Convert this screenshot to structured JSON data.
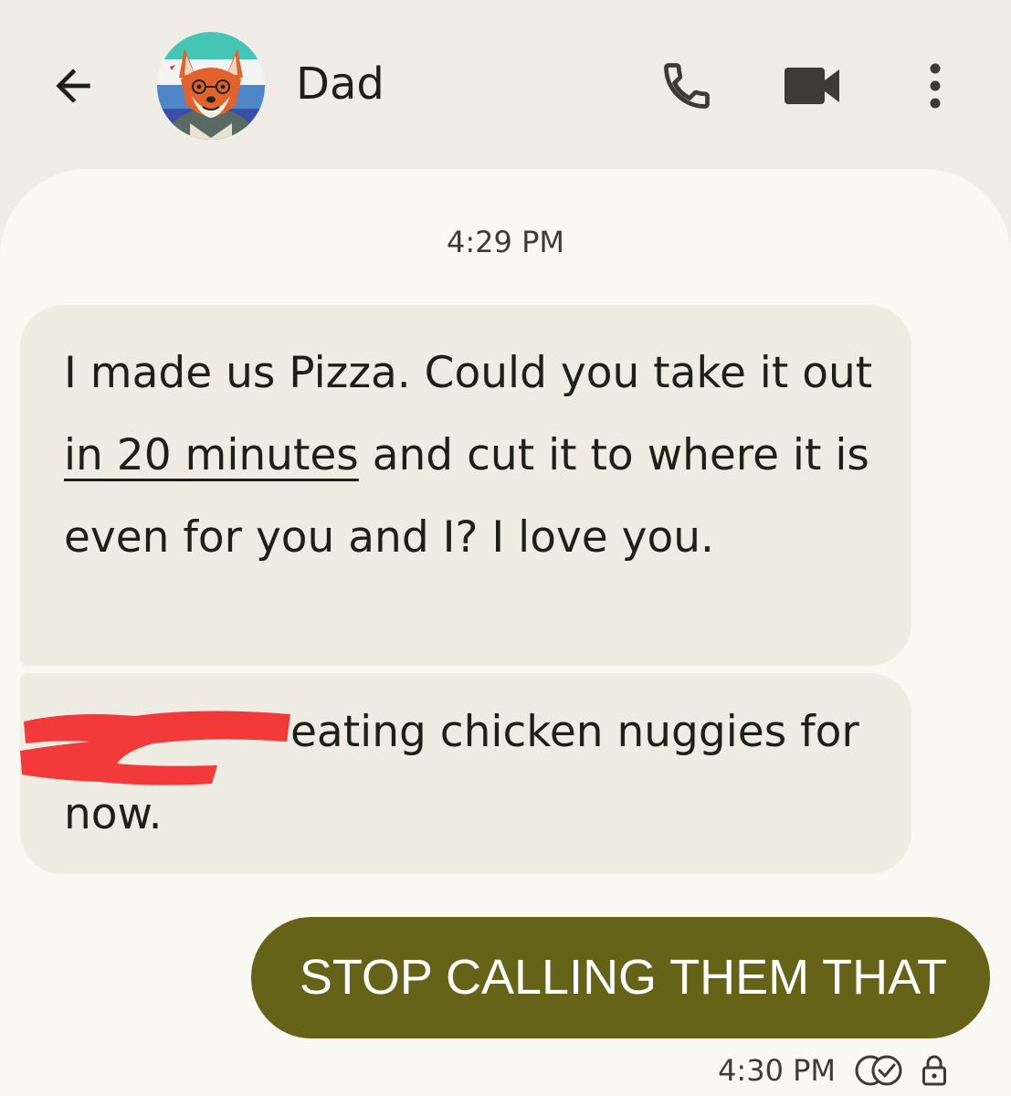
{
  "header": {
    "contact_name": "Dad",
    "back_icon": "arrow-left-icon",
    "call_icon": "phone-icon",
    "video_icon": "video-camera-icon",
    "more_icon": "more-vertical-icon"
  },
  "conversation": {
    "timestamp": "4:29 PM",
    "incoming": [
      {
        "before_link": "I made us Pizza.  Could you take it out ",
        "link": "in 20 minutes",
        "after_link": " and cut it to where it is even for you and I?  I love you."
      },
      {
        "text": "eating chicken nuggies for now.",
        "redacted": true
      }
    ],
    "outgoing": {
      "text": "STOP CALLING THEM THAT",
      "time": "4:30 PM",
      "status_icon": "delivered-check-icon",
      "lock_icon": "lock-icon"
    }
  },
  "colors": {
    "background": "#f0ede6",
    "conversation_bg": "#faf8f2",
    "incoming_bubble": "#efece4",
    "outgoing_bubble": "#646317",
    "redaction": "#f23a3a"
  }
}
